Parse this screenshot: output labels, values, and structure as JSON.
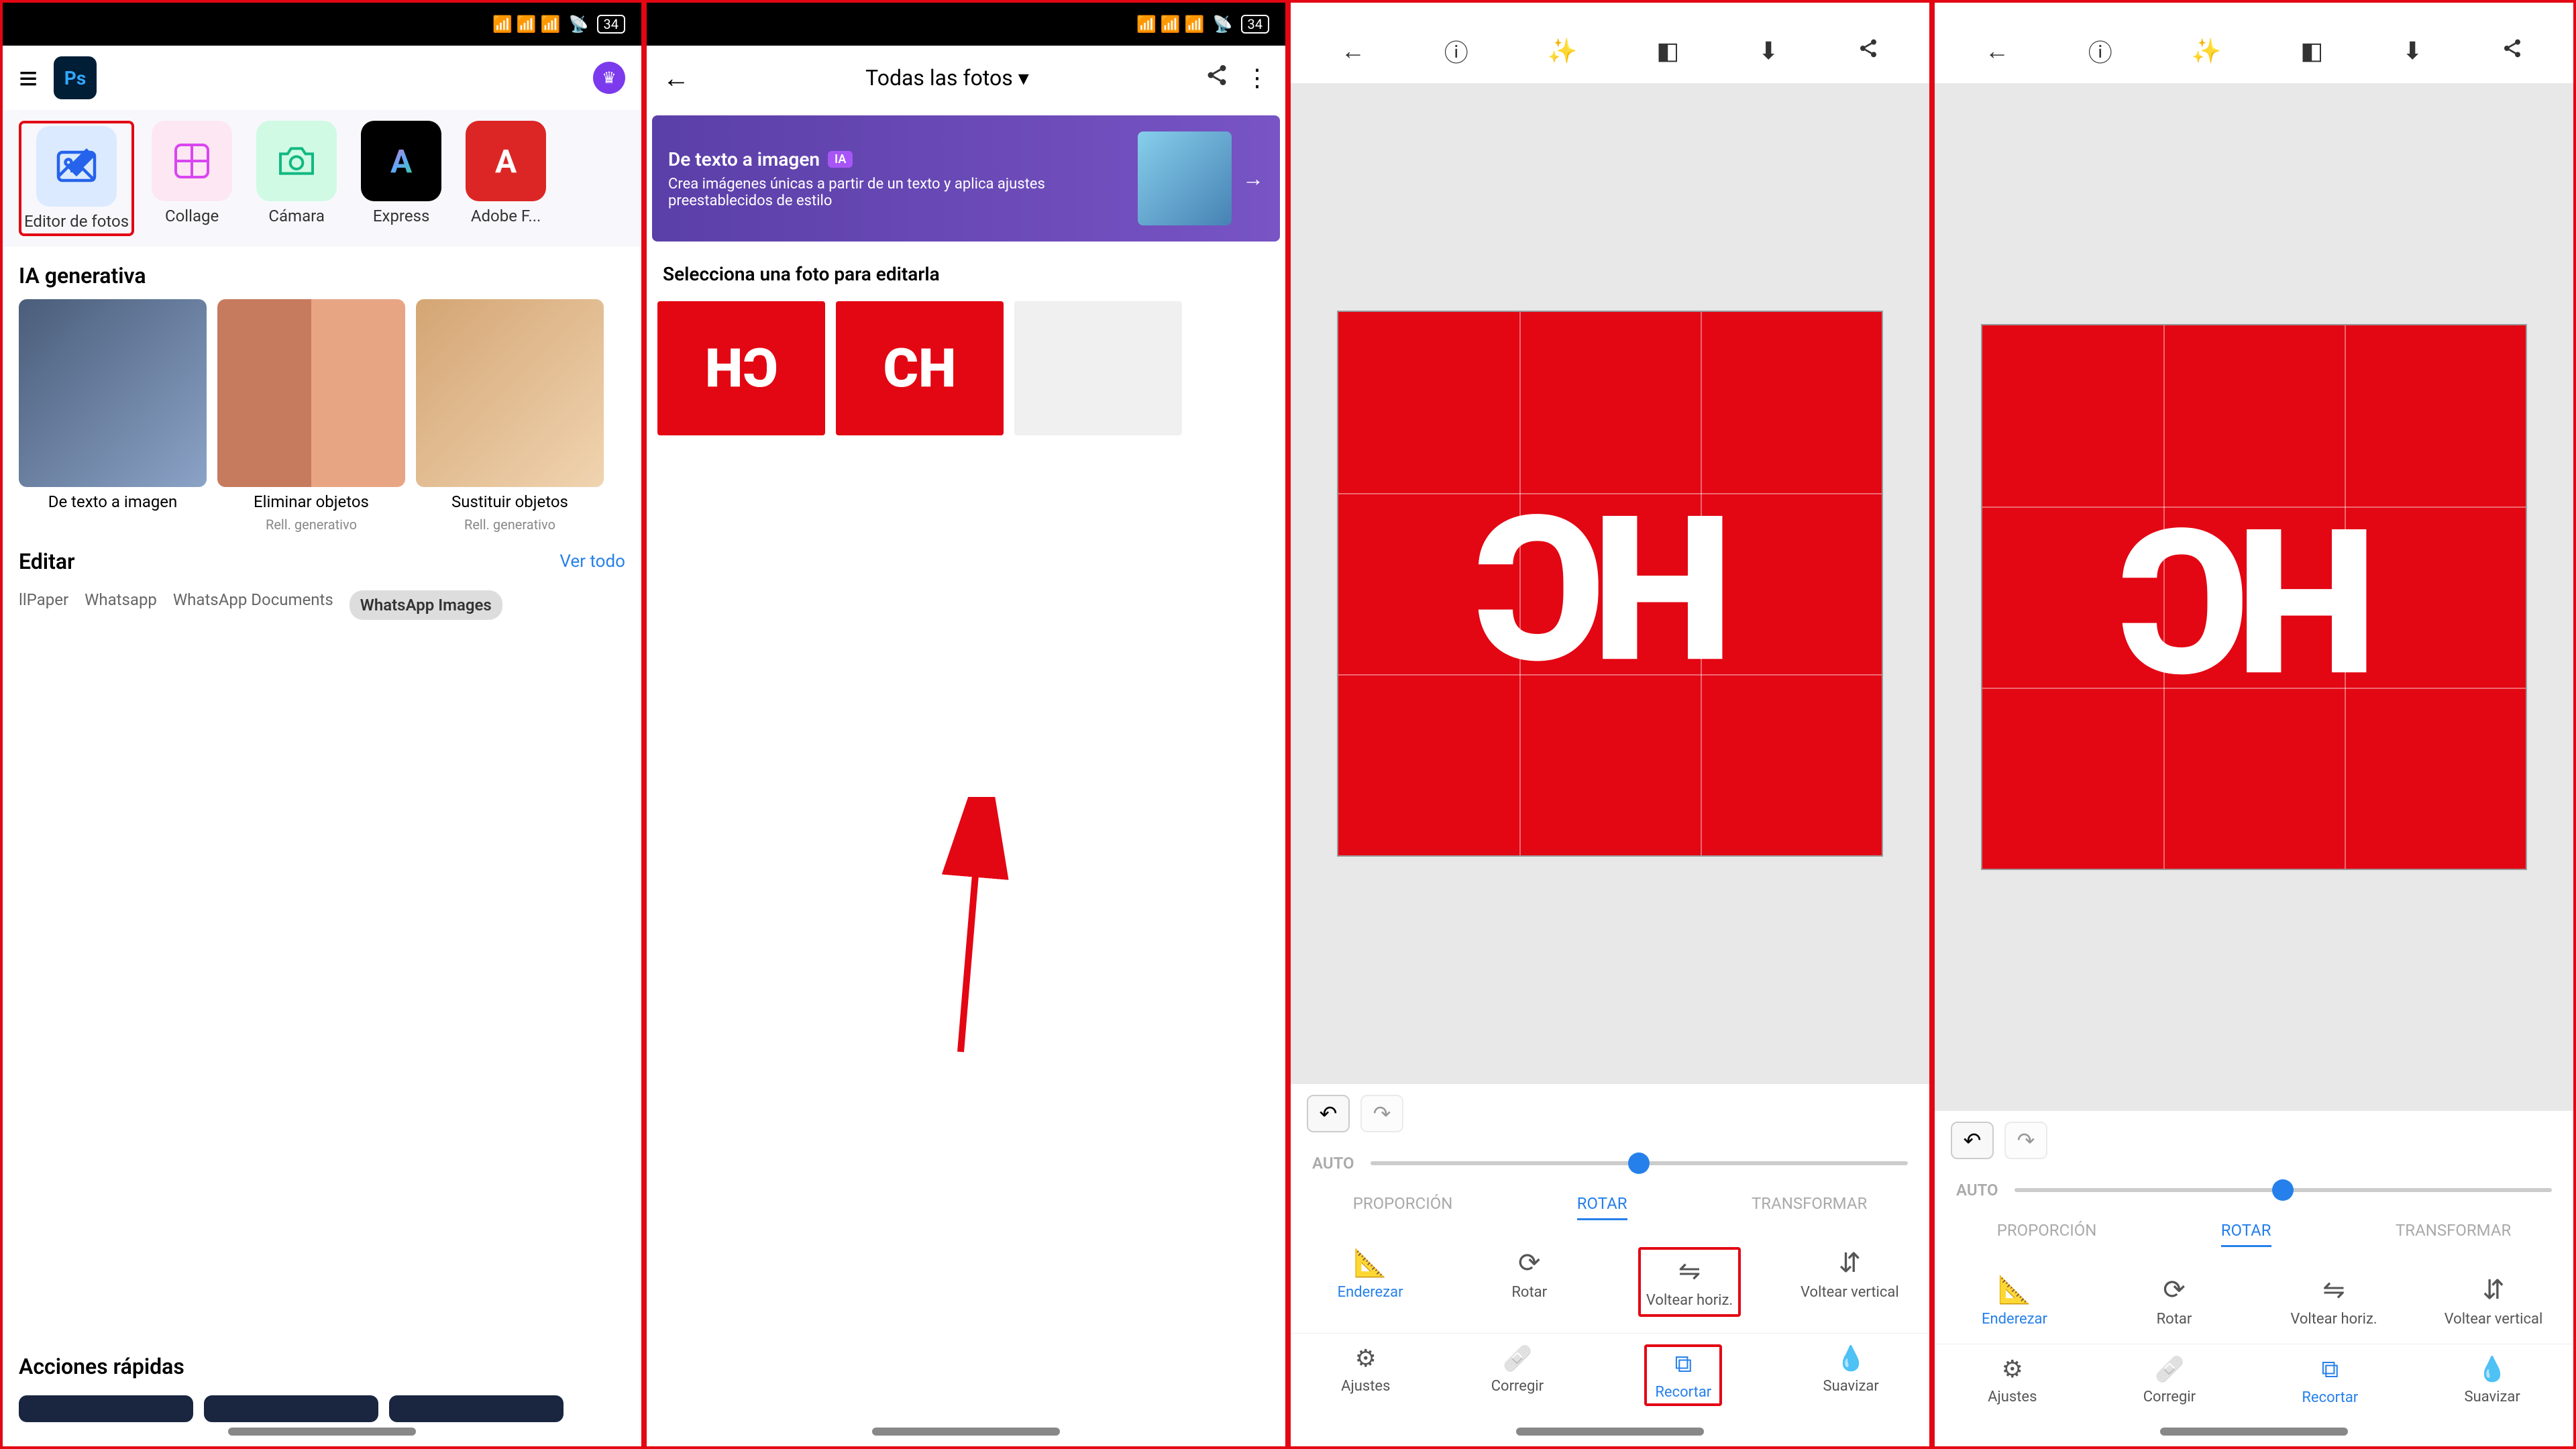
{
  "status": {
    "battery": "34"
  },
  "panel1": {
    "tools": [
      {
        "label": "Editor de fotos",
        "bg": "#dbeafe",
        "icon": "🖼️"
      },
      {
        "label": "Collage",
        "bg": "#fce7f3",
        "icon": "▦"
      },
      {
        "label": "Cámara",
        "bg": "#d1fae5",
        "icon": "📷"
      },
      {
        "label": "Express",
        "bg": "#000",
        "icon": "🅰️"
      },
      {
        "label": "Adobe F...",
        "bg": "#dc2626",
        "icon": "A"
      }
    ],
    "ia_title": "IA generativa",
    "ia_items": [
      {
        "label": "De texto a imagen",
        "sub": ""
      },
      {
        "label": "Eliminar objetos",
        "sub": "Rell. generativo"
      },
      {
        "label": "Sustituir objetos",
        "sub": "Rell. generativo"
      }
    ],
    "editar_title": "Editar",
    "ver_todo": "Ver todo",
    "tabs": [
      "llPaper",
      "Whatsapp",
      "WhatsApp Documents",
      "WhatsApp Images"
    ],
    "acciones_title": "Acciones rápidas"
  },
  "panel2": {
    "title": "Todas las fotos",
    "banner_title": "De texto a imagen",
    "banner_badge": "IA",
    "banner_sub": "Crea imágenes únicas a partir de un texto y aplica ajustes preestablecidos de estilo",
    "select_text": "Selecciona una foto para editarla"
  },
  "editor": {
    "auto_label": "AUTO",
    "crop_tabs": [
      "PROPORCIÓN",
      "ROTAR",
      "TRANSFORMAR"
    ],
    "flip_items": [
      {
        "label": "Enderezar",
        "icon": "📐"
      },
      {
        "label": "Rotar",
        "icon": "🔄"
      },
      {
        "label": "Voltear horiz.",
        "icon": "⇋"
      },
      {
        "label": "Voltear vertical",
        "icon": "⇵"
      }
    ],
    "bottom_tools": [
      {
        "label": "Ajustes",
        "icon": "⚙"
      },
      {
        "label": "Corregir",
        "icon": "🩹"
      },
      {
        "label": "Recortar",
        "icon": "✂"
      },
      {
        "label": "Suavizar",
        "icon": "💧"
      }
    ]
  }
}
